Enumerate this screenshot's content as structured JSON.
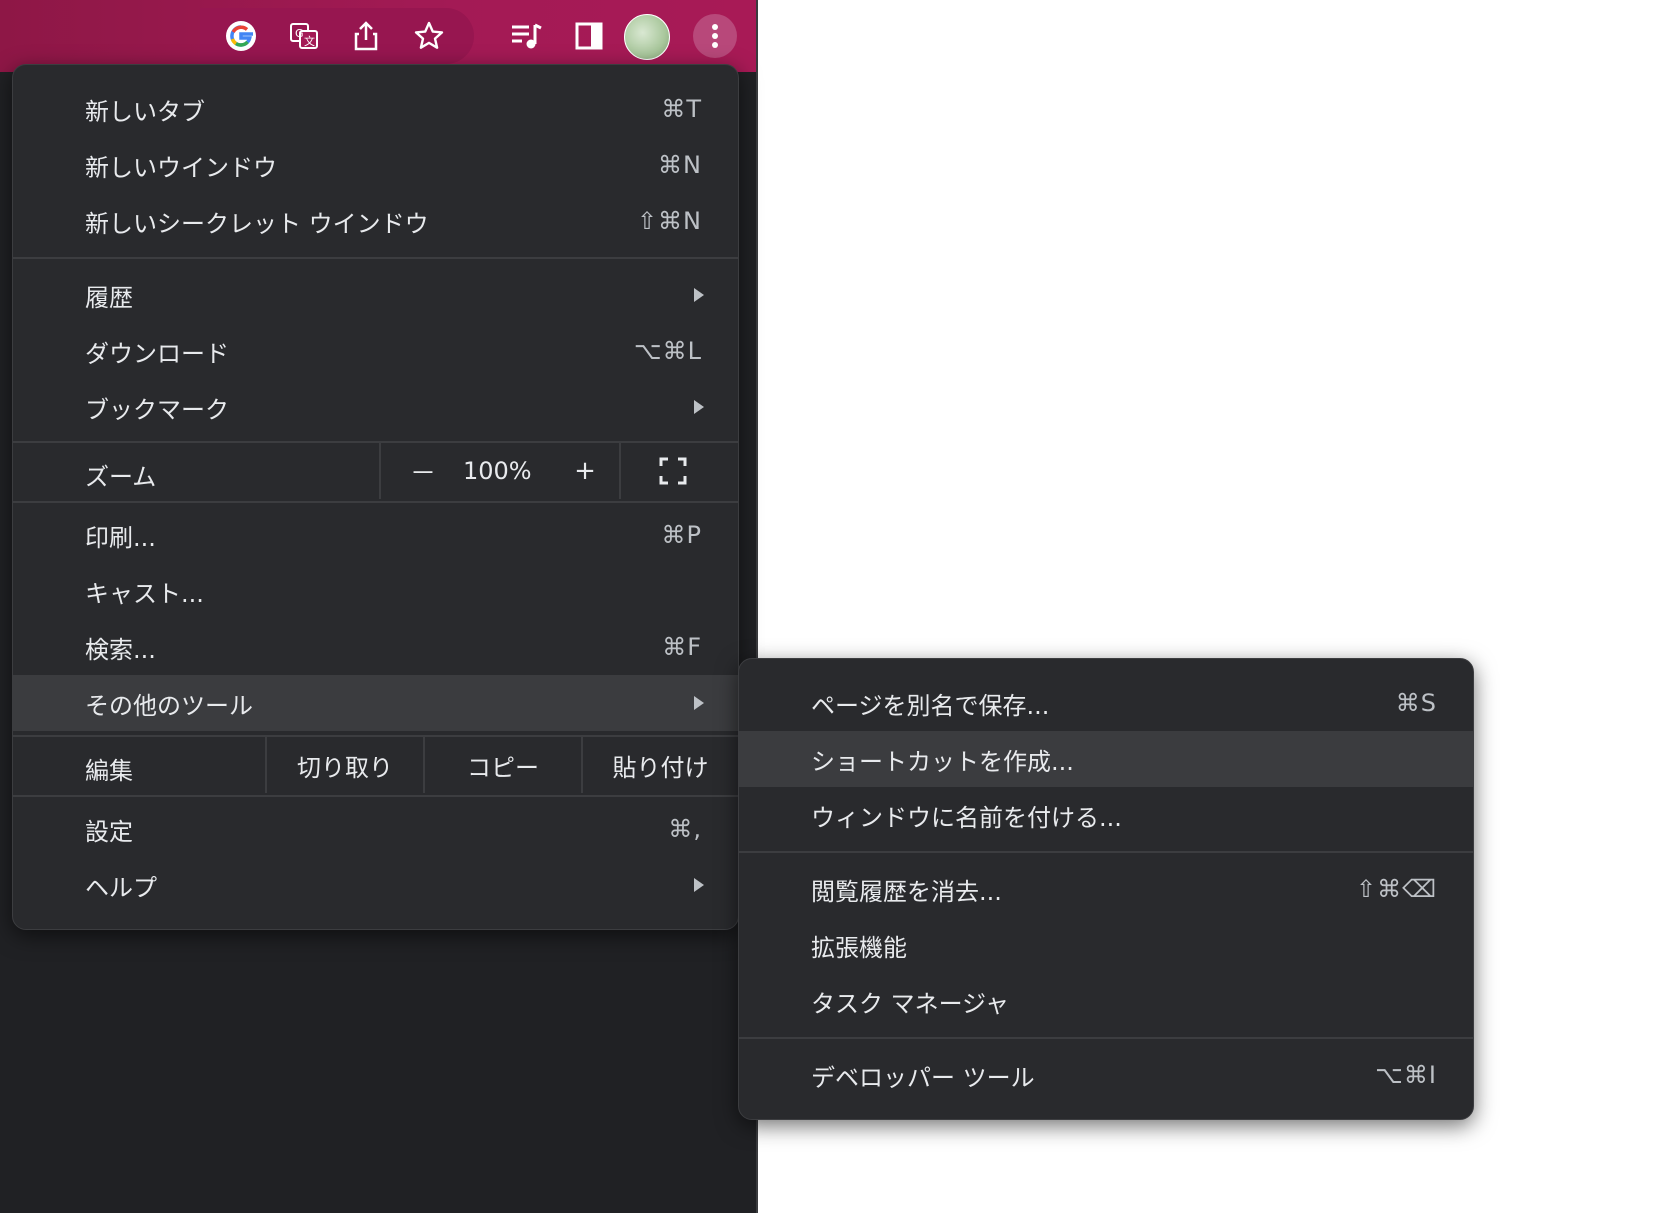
{
  "toolbar": {
    "icons": [
      "google-icon",
      "translate-icon",
      "share-icon",
      "star-icon",
      "media-controls-icon",
      "side-panel-icon",
      "profile-avatar",
      "kebab-menu-icon"
    ],
    "accent": "#a31a55"
  },
  "main_menu": {
    "new_tab": {
      "label": "新しいタブ",
      "shortcut": "⌘T"
    },
    "new_window": {
      "label": "新しいウインドウ",
      "shortcut": "⌘N"
    },
    "new_incognito": {
      "label": "新しいシークレット ウインドウ",
      "shortcut": "⇧⌘N"
    },
    "history": {
      "label": "履歴"
    },
    "downloads": {
      "label": "ダウンロード",
      "shortcut": "⌥⌘L"
    },
    "bookmarks": {
      "label": "ブックマーク"
    },
    "zoom": {
      "label": "ズーム",
      "minus": "－",
      "value": "100%",
      "plus": "+"
    },
    "print": {
      "label": "印刷...",
      "shortcut": "⌘P"
    },
    "cast": {
      "label": "キャスト..."
    },
    "find": {
      "label": "検索...",
      "shortcut": "⌘F"
    },
    "more_tools": {
      "label": "その他のツール"
    },
    "edit": {
      "label": "編集",
      "cut": "切り取り",
      "copy": "コピー",
      "paste": "貼り付け"
    },
    "settings": {
      "label": "設定",
      "shortcut": "⌘,"
    },
    "help": {
      "label": "ヘルプ"
    }
  },
  "sub_menu": {
    "save_page": {
      "label": "ページを別名で保存...",
      "shortcut": "⌘S"
    },
    "create_shortcut": {
      "label": "ショートカットを作成..."
    },
    "name_window": {
      "label": "ウィンドウに名前を付ける..."
    },
    "clear_data": {
      "label": "閲覧履歴を消去...",
      "shortcut": "⇧⌘⌫"
    },
    "extensions": {
      "label": "拡張機能"
    },
    "task_manager": {
      "label": "タスク マネージャ"
    },
    "dev_tools": {
      "label": "デベロッパー ツール",
      "shortcut": "⌥⌘I"
    }
  }
}
